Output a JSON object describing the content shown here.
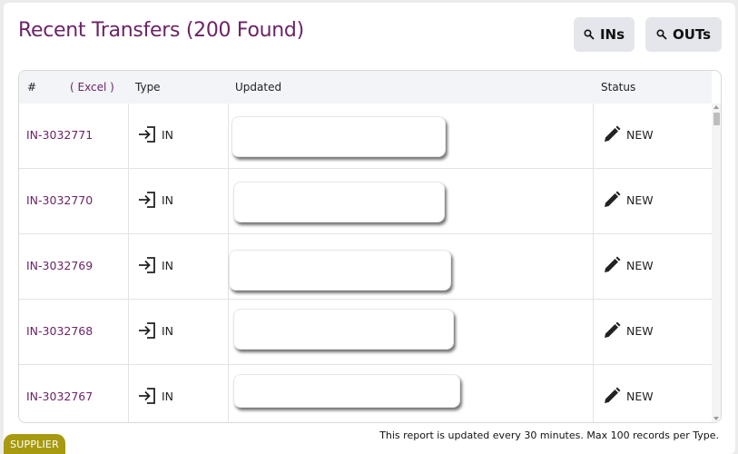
{
  "header": {
    "title": "Recent Transfers (200 Found)",
    "btn_ins": "INs",
    "btn_outs": "OUTs"
  },
  "table": {
    "columns": {
      "num": "#",
      "excel": "( Excel )",
      "type": "Type",
      "updated": "Updated",
      "status": "Status"
    },
    "rows": [
      {
        "id": "IN-3032771",
        "type": "IN",
        "status": "NEW"
      },
      {
        "id": "IN-3032770",
        "type": "IN",
        "status": "NEW"
      },
      {
        "id": "IN-3032769",
        "type": "IN",
        "status": "NEW"
      },
      {
        "id": "IN-3032768",
        "type": "IN",
        "status": "NEW"
      },
      {
        "id": "IN-3032767",
        "type": "IN",
        "status": "NEW"
      }
    ]
  },
  "footer": {
    "note": "This report is updated every 30 minutes. Max 100 records per Type.",
    "badge": "SUPPLIER"
  },
  "colors": {
    "accent": "#6b2466",
    "badge": "#a79a10"
  },
  "icons": {
    "search": "search-icon",
    "type_in": "login-arrow-icon",
    "status": "pencil-icon"
  }
}
